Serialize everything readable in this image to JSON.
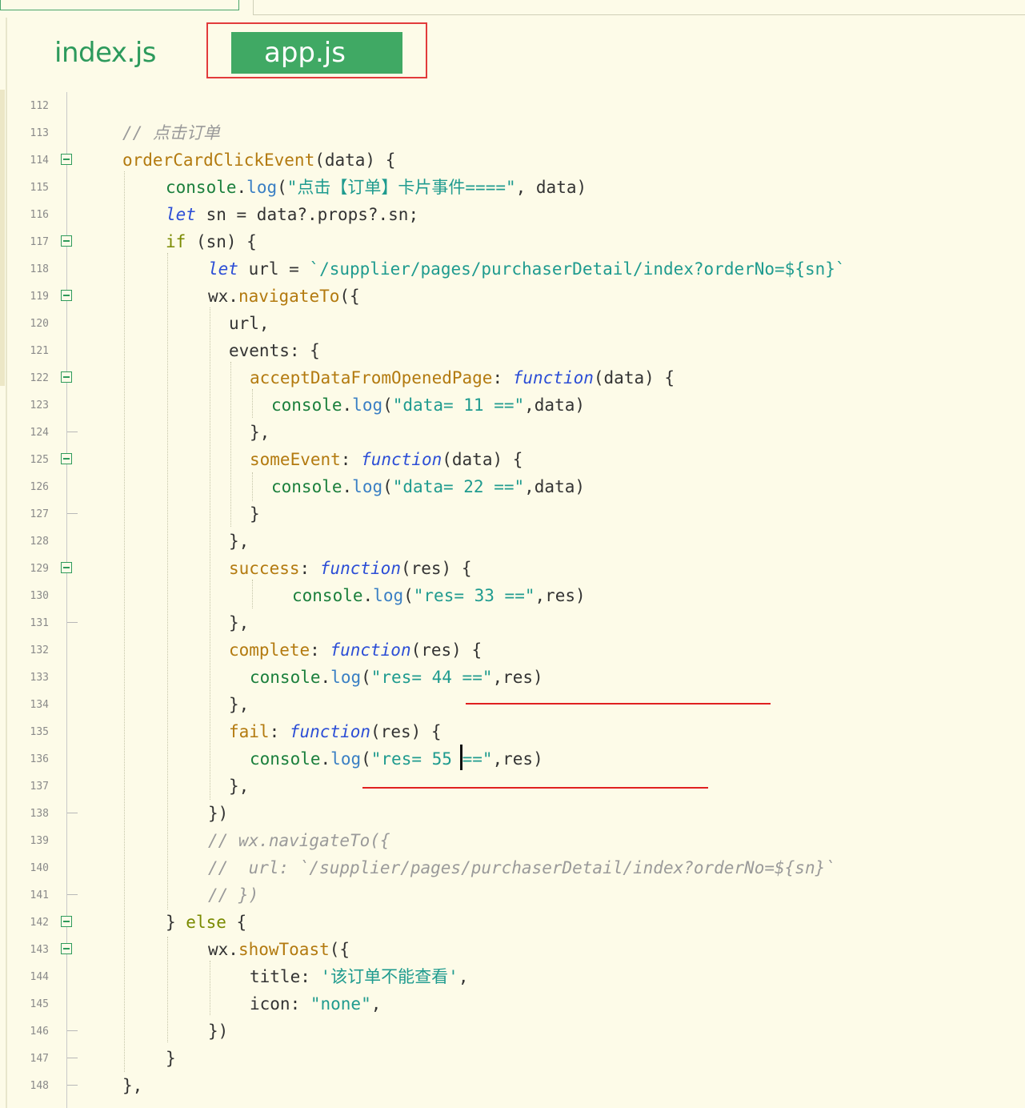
{
  "tabs": [
    {
      "label": "index.js",
      "active": false
    },
    {
      "label": "app.js",
      "active": true
    }
  ],
  "colors": {
    "background": "#fdfbe8",
    "active_tab": "#40a964",
    "tab_text": "#2d9a5c",
    "highlight_box": "#e23b3b",
    "comment": "#9a9a9a",
    "keyword": "#2c4ed6",
    "string": "#1f9b8f",
    "function_name": "#b37a0f"
  },
  "editor": {
    "lines": [
      {
        "n": "112"
      },
      {
        "n": "113"
      },
      {
        "n": "114"
      },
      {
        "n": "115"
      },
      {
        "n": "116"
      },
      {
        "n": "117"
      },
      {
        "n": "118"
      },
      {
        "n": "119"
      },
      {
        "n": "120"
      },
      {
        "n": "121"
      },
      {
        "n": "122"
      },
      {
        "n": "123"
      },
      {
        "n": "124"
      },
      {
        "n": "125"
      },
      {
        "n": "126"
      },
      {
        "n": "127"
      },
      {
        "n": "128"
      },
      {
        "n": "129"
      },
      {
        "n": "130"
      },
      {
        "n": "131"
      },
      {
        "n": "132"
      },
      {
        "n": "133"
      },
      {
        "n": "134"
      },
      {
        "n": "135"
      },
      {
        "n": "136"
      },
      {
        "n": "137"
      },
      {
        "n": "138"
      },
      {
        "n": "139"
      },
      {
        "n": "140"
      },
      {
        "n": "141"
      },
      {
        "n": "142"
      },
      {
        "n": "143"
      },
      {
        "n": "144"
      },
      {
        "n": "145"
      },
      {
        "n": "146"
      },
      {
        "n": "147"
      },
      {
        "n": "148"
      }
    ],
    "code": {
      "l113": [
        "// 点击订单"
      ],
      "l114": [
        "orderCardClickEvent",
        "(data) {"
      ],
      "l115": [
        "console",
        ".",
        "log",
        "(",
        "\"点击【订单】卡片事件====\"",
        ", data)"
      ],
      "l116": [
        "let",
        " sn = data?.props?.sn;"
      ],
      "l117": [
        "if",
        " (sn) {"
      ],
      "l118": [
        "let",
        " url = ",
        "`/supplier/pages/purchaserDetail/index?orderNo=${sn}`"
      ],
      "l119": [
        "wx.",
        "navigateTo",
        "({"
      ],
      "l120": [
        "url,"
      ],
      "l121": [
        "events: {"
      ],
      "l122": [
        "acceptDataFromOpenedPage",
        ": ",
        "function",
        "(data) {"
      ],
      "l123": [
        "console",
        ".",
        "log",
        "(",
        "\"data= 11 ==\"",
        ",data)"
      ],
      "l124": [
        "},"
      ],
      "l125": [
        "someEvent",
        ": ",
        "function",
        "(data) {"
      ],
      "l126": [
        "console",
        ".",
        "log",
        "(",
        "\"data= 22 ==\"",
        ",data)"
      ],
      "l127": [
        "}"
      ],
      "l128": [
        "},"
      ],
      "l129": [
        "success",
        ": ",
        "function",
        "(res) {"
      ],
      "l130": [
        "console",
        ".",
        "log",
        "(",
        "\"res= 33 ==\"",
        ",res)"
      ],
      "l131": [
        "},"
      ],
      "l132": [
        "complete",
        ": ",
        "function",
        "(res) {"
      ],
      "l133": [
        "console",
        ".",
        "log",
        "(",
        "\"res= 44 ==\"",
        ",res)"
      ],
      "l134": [
        "},"
      ],
      "l135": [
        "fail",
        ": ",
        "function",
        "(res) {"
      ],
      "l136": [
        "console",
        ".",
        "log",
        "(",
        "\"res= 55",
        " ==\"",
        ",res)"
      ],
      "l137": [
        "},"
      ],
      "l138": [
        "})"
      ],
      "l139": [
        "// wx.navigateTo({"
      ],
      "l140": [
        "//  url: `/supplier/pages/purchaserDetail/index?orderNo=${sn}`"
      ],
      "l141": [
        "// })"
      ],
      "l142": [
        "} ",
        "else",
        " {"
      ],
      "l143": [
        "wx.",
        "showToast",
        "({"
      ],
      "l144": [
        "title: ",
        "'该订单不能查看'",
        ","
      ],
      "l145": [
        "icon: ",
        "\"none\"",
        ","
      ],
      "l146": [
        "})"
      ],
      "l147": [
        "}"
      ],
      "l148": [
        "},"
      ]
    }
  }
}
